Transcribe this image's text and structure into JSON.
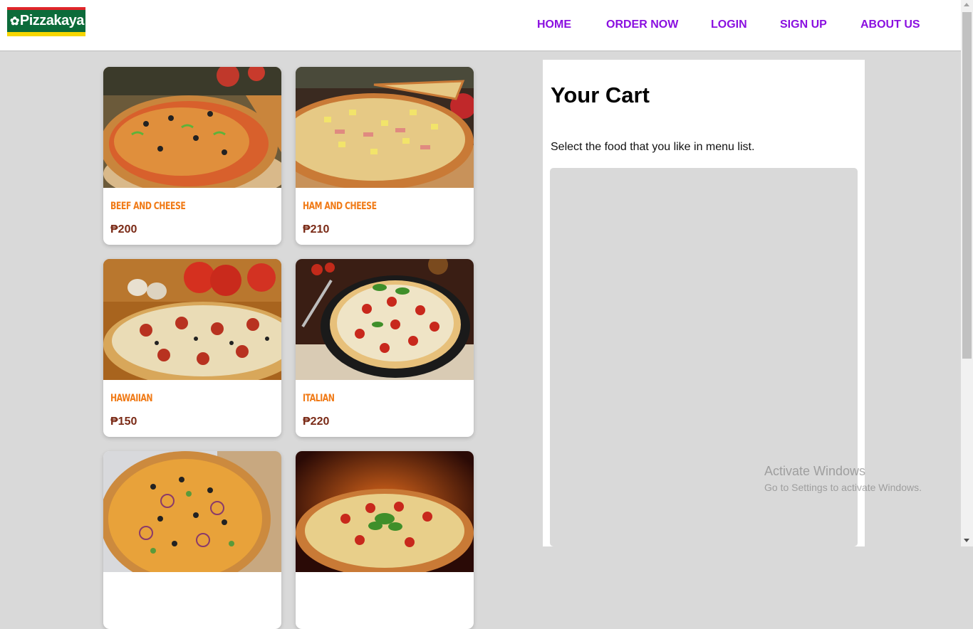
{
  "brand": {
    "logo_text": "Pizzakaya",
    "colors": {
      "red": "#e0262a",
      "green": "#0c6b3a",
      "yellow": "#f6d600"
    }
  },
  "nav": {
    "items": [
      "HOME",
      "ORDER NOW",
      "LOGIN",
      "SIGN UP",
      "ABOUT US"
    ],
    "color": "#8a0fe0"
  },
  "menu": {
    "items": [
      {
        "name": "BEEF AND CHEESE",
        "price": "₱200",
        "image": "pizza-photo-beef-cheese"
      },
      {
        "name": "HAM AND CHEESE",
        "price": "₱210",
        "image": "pizza-photo-ham-cheese"
      },
      {
        "name": "HAWAIIAN",
        "price": "₱150",
        "image": "pizza-photo-hawaiian"
      },
      {
        "name": "ITALIAN",
        "price": "₱220",
        "image": "pizza-photo-italian"
      },
      {
        "name": "",
        "price": "",
        "image": "pizza-photo-5"
      },
      {
        "name": "",
        "price": "",
        "image": "pizza-photo-6"
      }
    ],
    "name_color": "#f07a16",
    "price_color": "#7a2a16"
  },
  "cart": {
    "title": "Your Cart",
    "hint": "Select the food that you like in menu list."
  },
  "watermark": {
    "line1": "Activate Windows",
    "line2": "Go to Settings to activate Windows."
  }
}
